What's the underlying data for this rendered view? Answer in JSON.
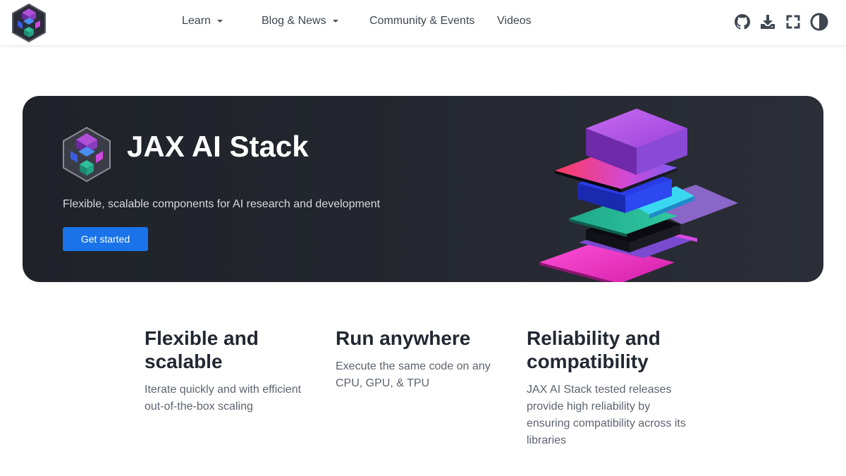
{
  "nav": {
    "links": [
      {
        "label": "Learn",
        "dropdown": true
      },
      {
        "label": "Blog & News",
        "dropdown": true
      },
      {
        "label": "Community & Events",
        "dropdown": false
      },
      {
        "label": "Videos",
        "dropdown": false
      }
    ],
    "icons": [
      "github-icon",
      "download-icon",
      "fullscreen-icon",
      "theme-toggle-icon"
    ]
  },
  "hero": {
    "title": "JAX AI Stack",
    "subtitle": "Flexible, scalable components for AI research and development",
    "button_label": "Get started"
  },
  "features": [
    {
      "title": "Flexible and scalable",
      "description": "Iterate quickly and with efficient out-of-the-box scaling"
    },
    {
      "title": "Run anywhere",
      "description": "Execute the same code on any CPU, GPU, & TPU"
    },
    {
      "title": "Reliability and compatibility",
      "description": "JAX AI Stack tested releases provide high reliability by ensuring compatibility across its libraries"
    }
  ],
  "colors": {
    "accent": "#1a73e8",
    "hero_background": "#24272f",
    "text": "#222832",
    "muted_text": "#5c6370"
  }
}
